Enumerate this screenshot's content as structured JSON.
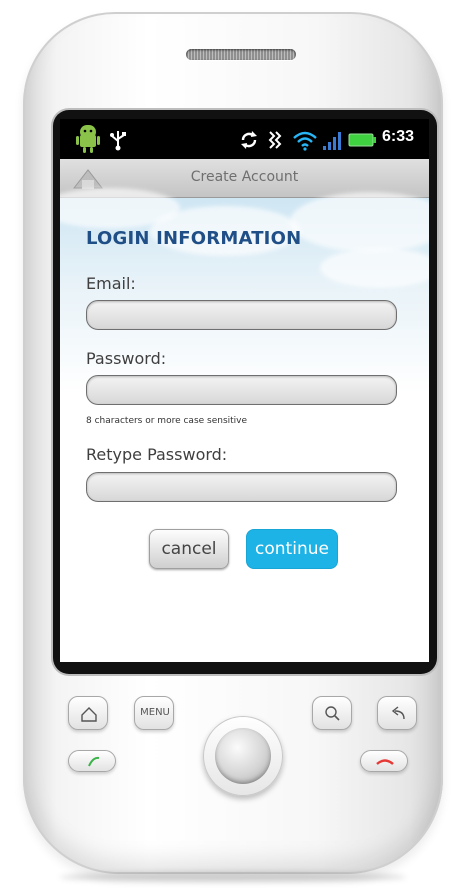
{
  "status_bar": {
    "time": "6:33",
    "icons": [
      "android-icon",
      "usb-icon",
      "sync-icon",
      "vibrate-icon",
      "wifi-icon",
      "signal-icon",
      "battery-icon"
    ]
  },
  "title_bar": {
    "title": "Create Account"
  },
  "form": {
    "section_title": "LOGIN INFORMATION",
    "email_label": "Email:",
    "email_value": "",
    "password_label": "Password:",
    "password_value": "",
    "password_hint": "8 characters or more case sensitive",
    "retype_label": "Retype Password:",
    "retype_value": ""
  },
  "actions": {
    "cancel_label": "cancel",
    "continue_label": "continue"
  },
  "hardware": {
    "menu_label": "MENU"
  },
  "colors": {
    "accent": "#1eb3e6",
    "section_title": "#1f4f86"
  }
}
